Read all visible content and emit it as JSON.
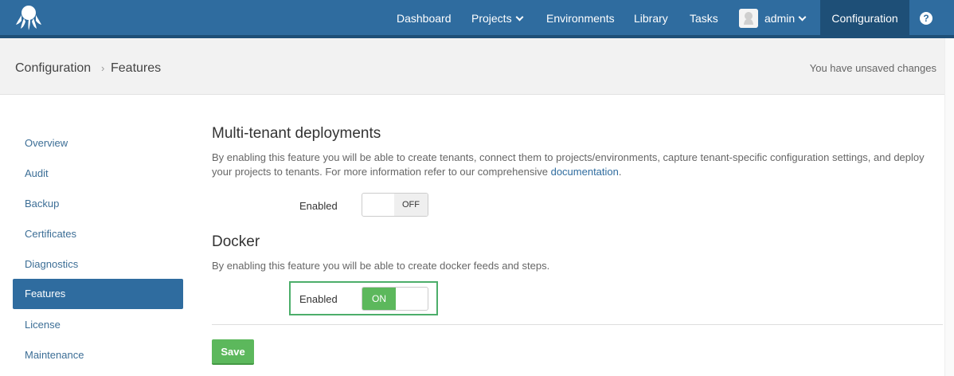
{
  "nav": {
    "items": [
      {
        "label": "Dashboard"
      },
      {
        "label": "Projects"
      },
      {
        "label": "Environments"
      },
      {
        "label": "Library"
      },
      {
        "label": "Tasks"
      }
    ],
    "user": "admin",
    "configuration": "Configuration",
    "help": "?"
  },
  "breadcrumb": {
    "root": "Configuration",
    "current": "Features",
    "status": "You have unsaved changes"
  },
  "sidebar": {
    "items": [
      {
        "label": "Overview"
      },
      {
        "label": "Audit"
      },
      {
        "label": "Backup"
      },
      {
        "label": "Certificates"
      },
      {
        "label": "Diagnostics"
      },
      {
        "label": "Features"
      },
      {
        "label": "License"
      },
      {
        "label": "Maintenance"
      }
    ],
    "active": "Features"
  },
  "features": {
    "multitenant": {
      "title": "Multi-tenant deployments",
      "desc_before": "By enabling this feature you will be able to create tenants, connect them to projects/environments, capture tenant-specific configuration settings, and deploy your projects to tenants. For more information refer to our comprehensive ",
      "link": "documentation",
      "desc_after": ".",
      "label": "Enabled",
      "state": "OFF"
    },
    "docker": {
      "title": "Docker",
      "desc": "By enabling this feature you will be able to create docker feeds and steps.",
      "label": "Enabled",
      "state": "ON"
    }
  },
  "actions": {
    "save": "Save"
  },
  "colors": {
    "nav": "#2f6c9f",
    "nav_dark": "#1e4f77",
    "on": "#5cb85c",
    "highlight": "#4cae6a"
  }
}
